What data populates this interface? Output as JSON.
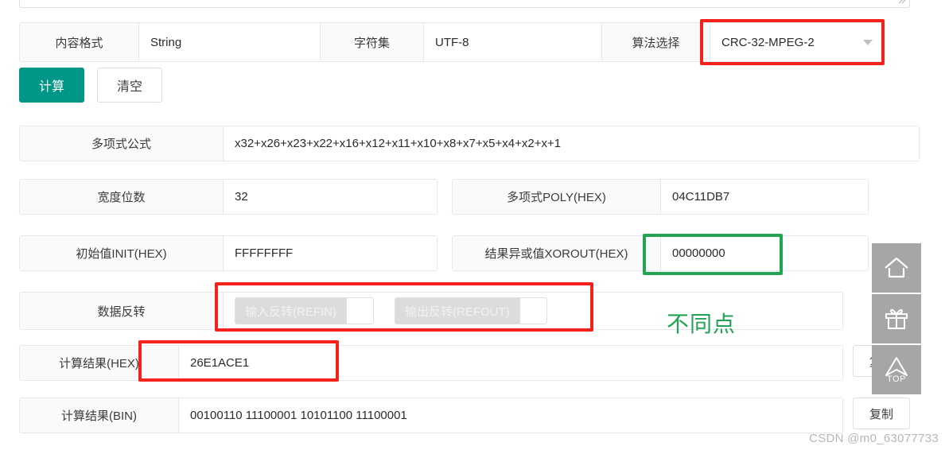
{
  "toolbar": {
    "content_format": {
      "label": "内容格式",
      "value": "String"
    },
    "charset": {
      "label": "字符集",
      "value": "UTF-8"
    },
    "algorithm": {
      "label": "算法选择",
      "value": "CRC-32-MPEG-2"
    }
  },
  "actions": {
    "calculate_label": "计算",
    "clear_label": "清空",
    "copy_label": "复制"
  },
  "params": {
    "polynomial_formula": {
      "label": "多项式公式",
      "value": "x32+x26+x23+x22+x16+x12+x11+x10+x8+x7+x5+x4+x2+x+1"
    },
    "width_bits": {
      "label": "宽度位数",
      "value": "32"
    },
    "poly_hex": {
      "label": "多项式POLY(HEX)",
      "value": "04C11DB7"
    },
    "init_hex": {
      "label": "初始值INIT(HEX)",
      "value": "FFFFFFFF"
    },
    "xorout_hex": {
      "label": "结果异或值XOROUT(HEX)",
      "value": "00000000"
    },
    "data_reverse": {
      "label": "数据反转",
      "refin_label": "输入反转(REFIN)",
      "refout_label": "输出反转(REFOUT)"
    }
  },
  "results": {
    "hex": {
      "label": "计算结果(HEX)",
      "value": "26E1ACE1"
    },
    "bin": {
      "label": "计算结果(BIN)",
      "value": "00100110 11100001 10101100 11100001"
    }
  },
  "annotations": {
    "difference_note": "不同点",
    "accent_red": "#f5221b",
    "accent_green": "#23a455",
    "accent_primary": "#009688"
  },
  "float_buttons": {
    "home_name": "home-icon",
    "gift_name": "gift-icon",
    "top_label": "TOP"
  },
  "watermark": {
    "text": "CSDN @m0_63077733"
  }
}
